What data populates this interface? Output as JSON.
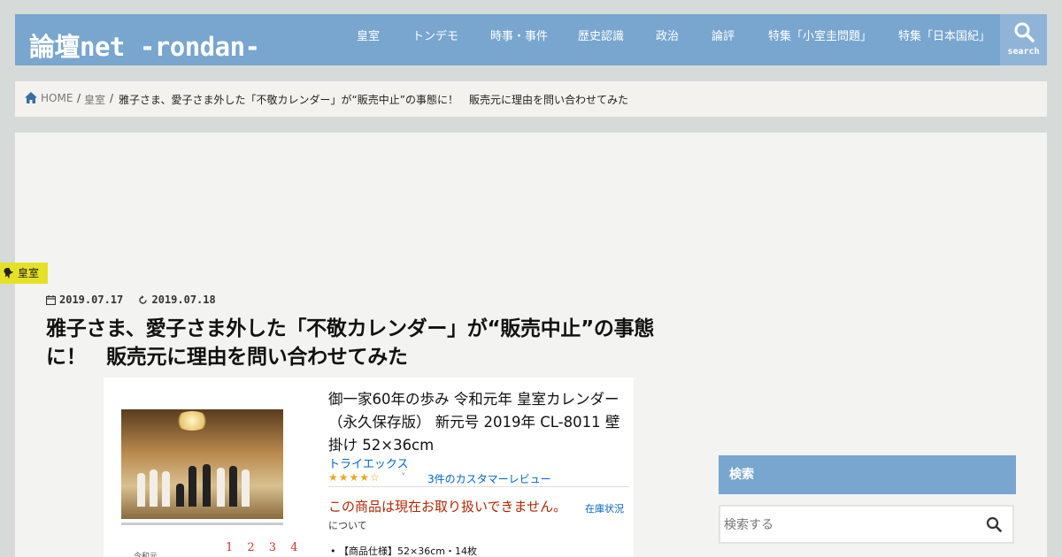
{
  "site": {
    "logo": "論壇net -rondan-"
  },
  "nav": {
    "items": [
      {
        "label": "皇室"
      },
      {
        "label": "トンデモ"
      },
      {
        "label": "時事・事件"
      },
      {
        "label": "歴史認識"
      },
      {
        "label": "政治"
      },
      {
        "label": "論評"
      },
      {
        "label": "特集「小室圭問題」"
      },
      {
        "label": "特集「日本国紀」"
      }
    ],
    "search_label": "search"
  },
  "breadcrumb": {
    "home": "HOME",
    "category": "皇室",
    "separator": "/",
    "current": "雅子さま、愛子さま外した「不敬カレンダー」が“販売中止”の事態に！　販売元に理由を問い合わせてみた"
  },
  "article": {
    "category": "皇室",
    "published": "2019.07.17",
    "updated": "2019.07.18",
    "title": "雅子さま、愛子さま外した「不敬カレンダー」が“販売中止”の事態に！　販売元に理由を問い合わせてみた"
  },
  "screenshot": {
    "product_title": "御一家60年の歩み 令和元年 皇室カレンダー （永久保存版） 新元号 2019年 CL-8011 壁掛け 52×36cm",
    "brand": "トライエックス",
    "rating_stars": 3.5,
    "stars_text": "★★★★☆",
    "chevron": "˅",
    "reviews": "3件のカスタマーレビュー",
    "unavailable": "この商品は現在お取り扱いできません。",
    "stock_link": "在庫状況",
    "about": "について",
    "spec": "• 【商品仕様】52×36cm・14枚",
    "calendar_numbers": "1 2 3 4",
    "calendar_side": "令和元"
  },
  "sidebar": {
    "search_heading": "検索",
    "search_placeholder": "検索する"
  },
  "colors": {
    "header": "#78a6cf",
    "category_tag": "#e5e126",
    "background": "#d6dbd9"
  }
}
